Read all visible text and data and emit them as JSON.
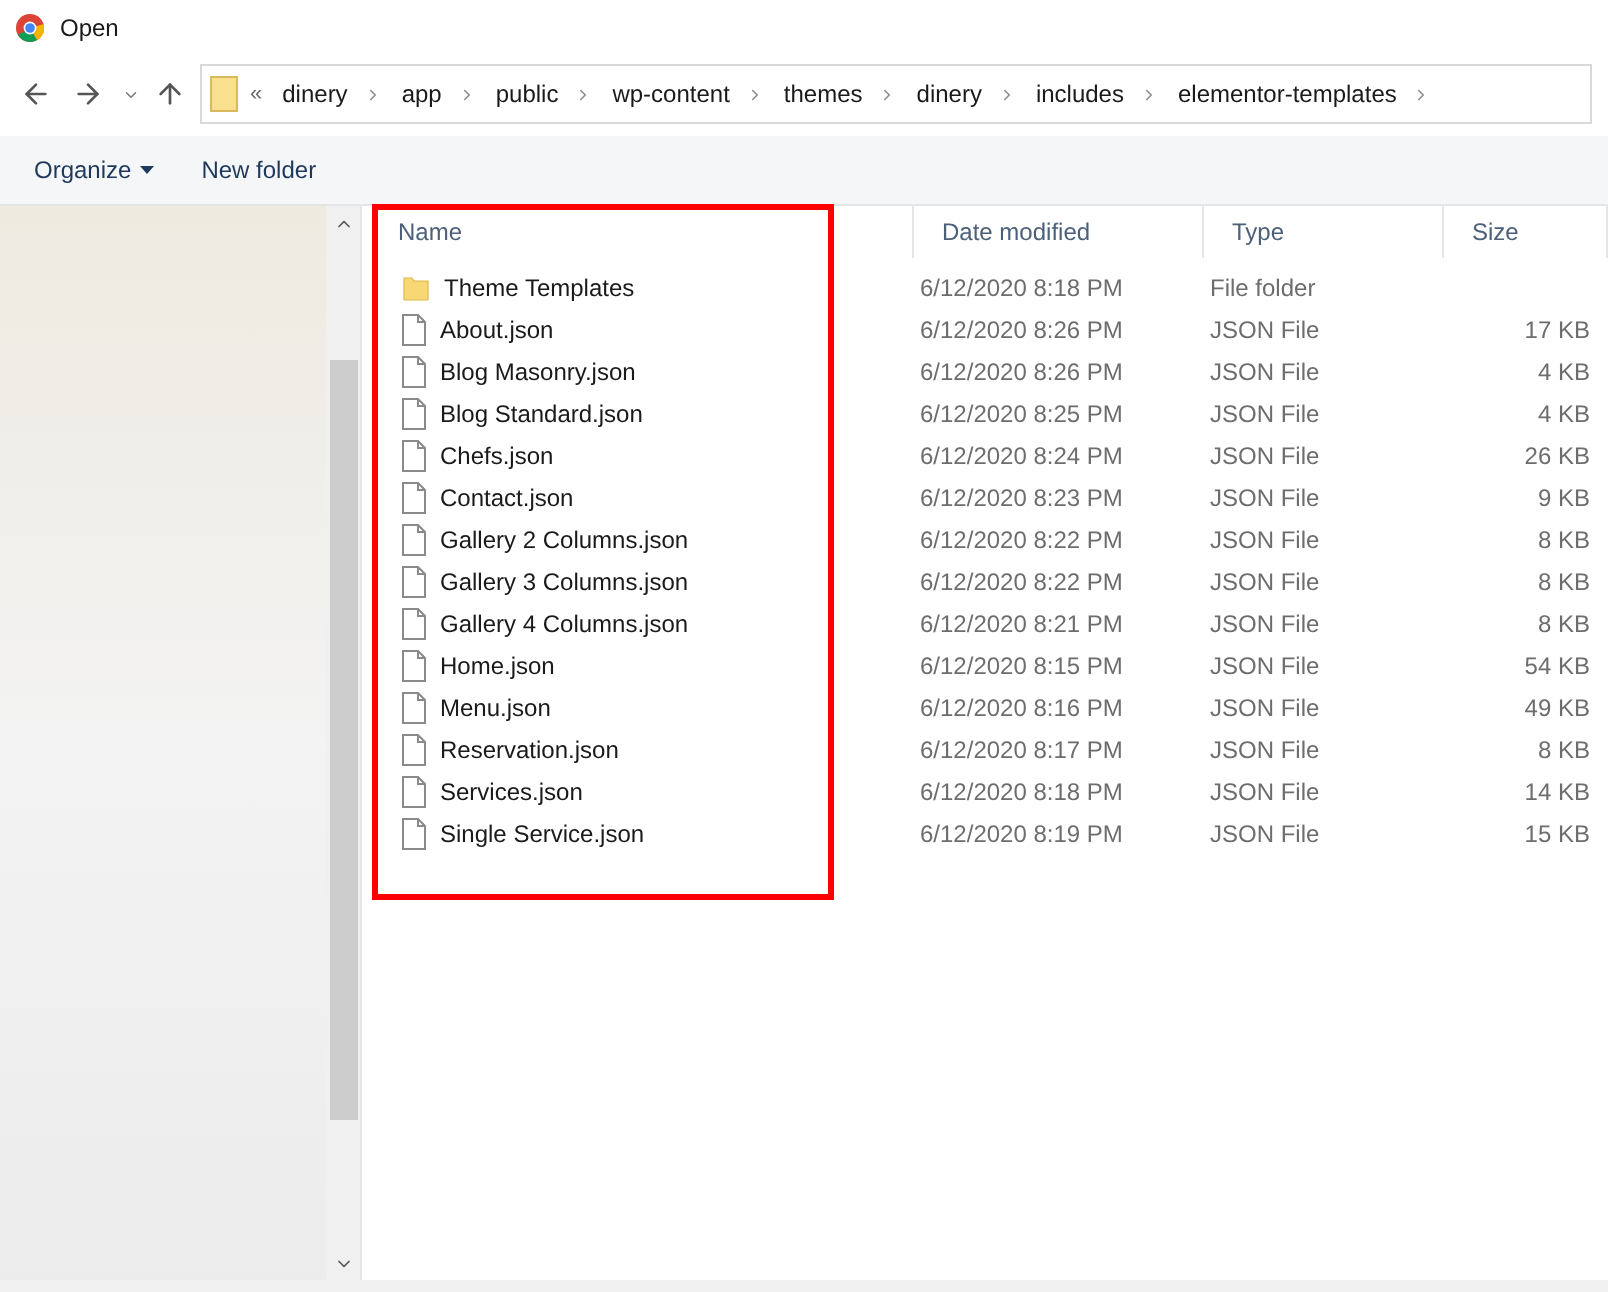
{
  "window": {
    "title": "Open"
  },
  "breadcrumb": {
    "overflow": "«",
    "segments": [
      "dinery",
      "app",
      "public",
      "wp-content",
      "themes",
      "dinery",
      "includes",
      "elementor-templates"
    ]
  },
  "toolbar": {
    "organize": "Organize",
    "new_folder": "New folder"
  },
  "table": {
    "columns": [
      "Name",
      "Date modified",
      "Type",
      "Size"
    ],
    "rows": [
      {
        "kind": "folder",
        "name": "Theme Templates",
        "date": "6/12/2020 8:18 PM",
        "type": "File folder"
      },
      {
        "kind": "file",
        "name": "About.json",
        "date": "6/12/2020 8:26 PM",
        "type": "JSON File",
        "size": "17 KB"
      },
      {
        "kind": "file",
        "name": "Blog Masonry.json",
        "date": "6/12/2020 8:26 PM",
        "type": "JSON File",
        "size": "4 KB"
      },
      {
        "kind": "file",
        "name": "Blog Standard.json",
        "date": "6/12/2020 8:25 PM",
        "type": "JSON File",
        "size": "4 KB"
      },
      {
        "kind": "file",
        "name": "Chefs.json",
        "date": "6/12/2020 8:24 PM",
        "type": "JSON File",
        "size": "26 KB"
      },
      {
        "kind": "file",
        "name": "Contact.json",
        "date": "6/12/2020 8:23 PM",
        "type": "JSON File",
        "size": "9 KB"
      },
      {
        "kind": "file",
        "name": "Gallery 2 Columns.json",
        "date": "6/12/2020 8:22 PM",
        "type": "JSON File",
        "size": "8 KB"
      },
      {
        "kind": "file",
        "name": "Gallery 3 Columns.json",
        "date": "6/12/2020 8:22 PM",
        "type": "JSON File",
        "size": "8 KB"
      },
      {
        "kind": "file",
        "name": "Gallery 4 Columns.json",
        "date": "6/12/2020 8:21 PM",
        "type": "JSON File",
        "size": "8 KB"
      },
      {
        "kind": "file",
        "name": "Home.json",
        "date": "6/12/2020 8:15 PM",
        "type": "JSON File",
        "size": "54 KB"
      },
      {
        "kind": "file",
        "name": "Menu.json",
        "date": "6/12/2020 8:16 PM",
        "type": "JSON File",
        "size": "49 KB"
      },
      {
        "kind": "file",
        "name": "Reservation.json",
        "date": "6/12/2020 8:17 PM",
        "type": "JSON File",
        "size": "8 KB"
      },
      {
        "kind": "file",
        "name": "Services.json",
        "date": "6/12/2020 8:18 PM",
        "type": "JSON File",
        "size": "14 KB"
      },
      {
        "kind": "file",
        "name": "Single Service.json",
        "date": "6/12/2020 8:19 PM",
        "type": "JSON File",
        "size": "15 KB"
      }
    ]
  }
}
